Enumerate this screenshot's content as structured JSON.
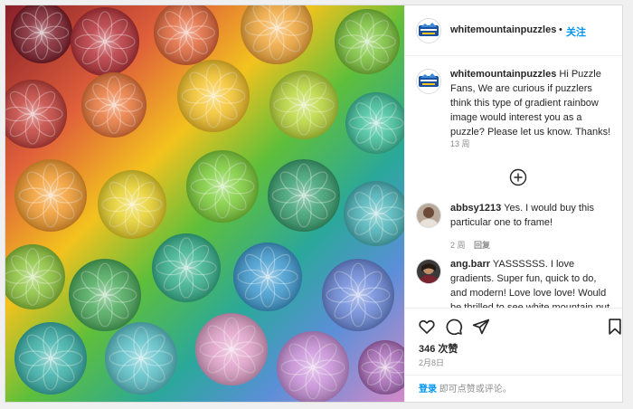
{
  "post": {
    "username": "whitemountainpuzzles",
    "follow_separator": "•",
    "follow_label": "关注",
    "avatar_text": "White Mountain Puzzles",
    "caption": {
      "username": "whitemountainpuzzles",
      "text": "Hi Puzzle Fans, We are curious if puzzlers think this type of gradient rainbow image would interest you as a puzzle? Please let us know. Thanks!",
      "age": "13 周"
    },
    "comments": [
      {
        "username": "abbsy1213",
        "text": "Yes. I would buy this particular one to frame!",
        "age": "2 周",
        "reply_label": "回复"
      },
      {
        "username": "ang.barr",
        "text": "YASSSSSS. I love gradients. Super fun, quick to do, and modern! Love love love! Would be thrilled to see white mountain put out some"
      }
    ],
    "likes": "346 次赞",
    "date": "2月8日",
    "login_link": "登录",
    "login_rest": " 即可点赞或评论。"
  },
  "icons": [
    "like-icon",
    "comment-icon",
    "share-icon",
    "save-icon",
    "load-more-icon"
  ],
  "colors": {
    "link": "#0095f6",
    "text": "#262626",
    "muted": "#8e8e8e"
  }
}
